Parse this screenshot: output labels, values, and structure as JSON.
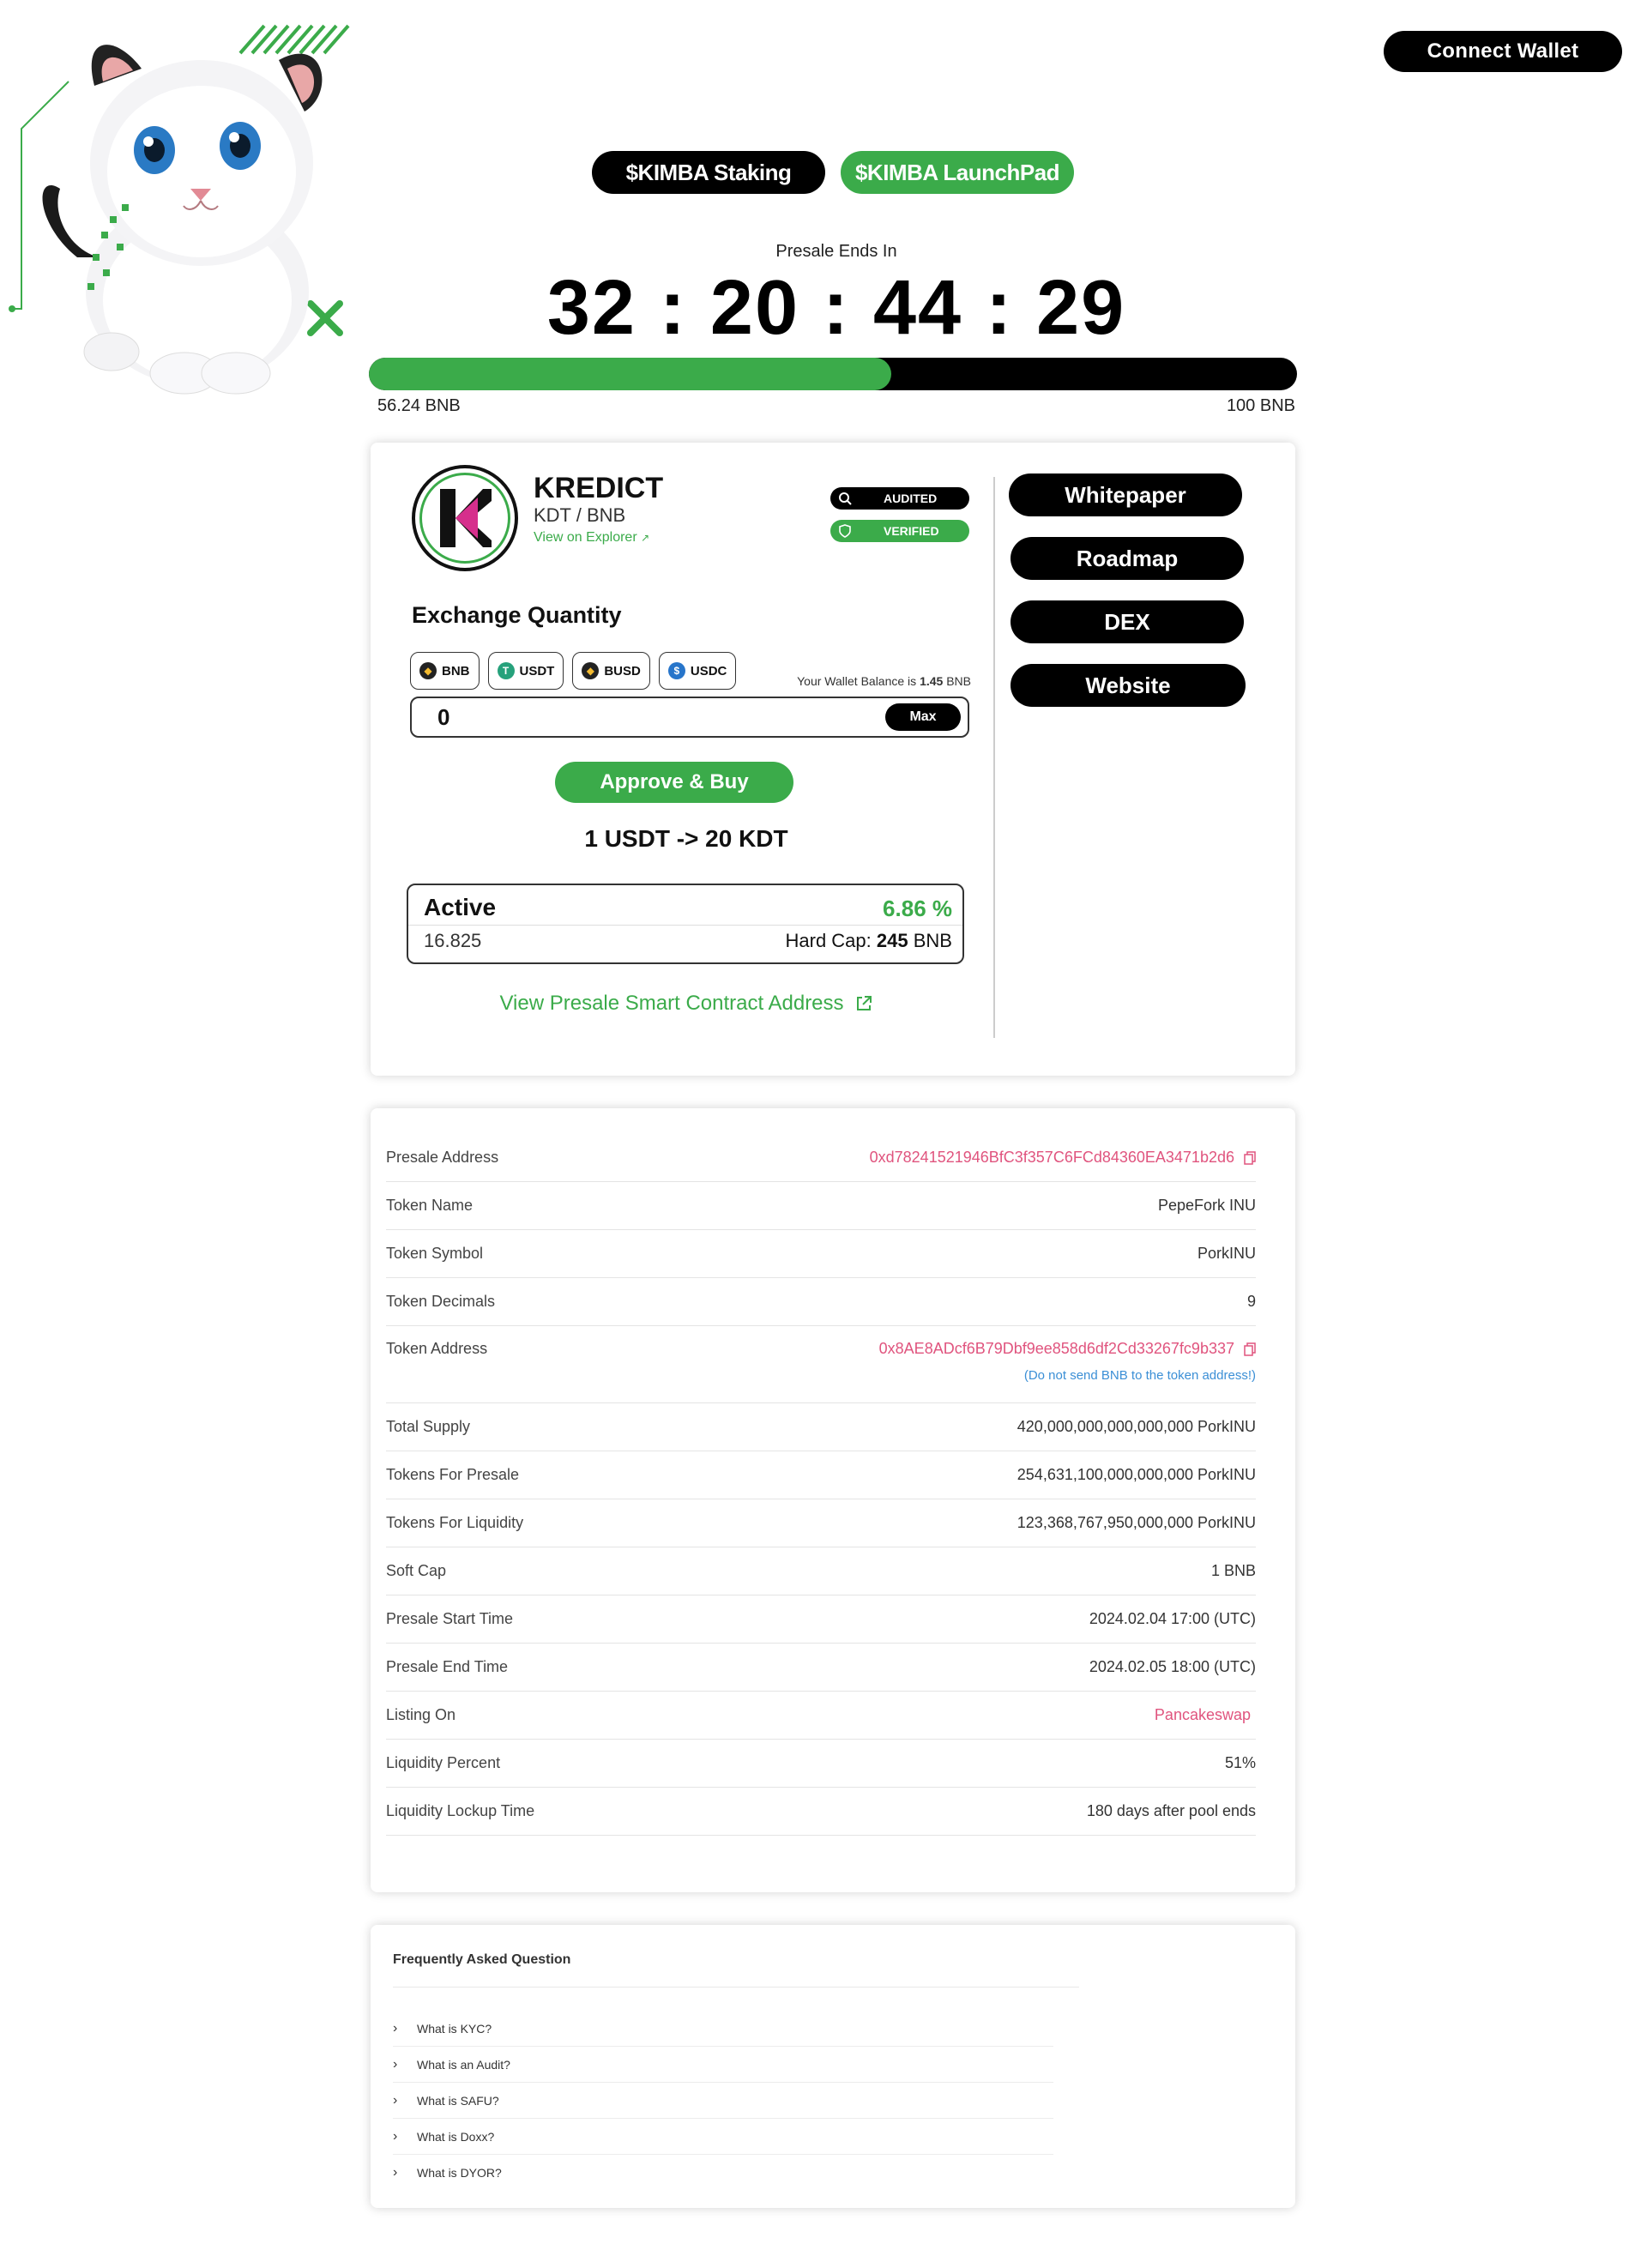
{
  "header": {
    "connect_label": "Connect Wallet",
    "tabs": [
      "$KIMBA Staking",
      "$KIMBA LaunchPad"
    ]
  },
  "presale": {
    "label": "Presale Ends In",
    "countdown": "32 : 20 : 44 : 29",
    "progress_fraction": 0.5624,
    "raised_label": "56.24 BNB",
    "goal_label": "100 BNB"
  },
  "token": {
    "name": "KREDICT",
    "pair": "KDT / BNB",
    "explorer_label": "View on Explorer",
    "badges": [
      "AUDITED",
      "VERIFIED"
    ]
  },
  "exchange": {
    "title": "Exchange Quantity",
    "currencies": [
      "BNB",
      "USDT",
      "BUSD",
      "USDC"
    ],
    "wallet_balance_prefix": "Your Wallet Balance is",
    "wallet_balance_value": "1.45",
    "wallet_balance_unit": "BNB",
    "amount_value": "0",
    "max_label": "Max",
    "approve_label": "Approve & Buy",
    "rate": "1 USDT -> 20 KDT"
  },
  "status": {
    "label": "Active",
    "percent": "6.86 %",
    "raised": "16.825",
    "hardcap_prefix": "Hard Cap:",
    "hardcap_value": "245",
    "hardcap_unit": "BNB"
  },
  "contract_link_label": "View Presale Smart Contract Address",
  "side_buttons": [
    "Whitepaper",
    "Roadmap",
    "DEX",
    "Website"
  ],
  "info": [
    {
      "label": "Presale Address",
      "value": "0xd78241521946BfC3f357C6FCd84360EA3471b2d6"
    },
    {
      "label": "Token Name",
      "value": "PepeFork INU"
    },
    {
      "label": "Token Symbol",
      "value": "PorkINU"
    },
    {
      "label": "Token Decimals",
      "value": "9"
    },
    {
      "label": "Token Address",
      "value": "0x8AE8ADcf6B79Dbf9ee858d6df2Cd33267fc9b337",
      "note": "(Do not send BNB to the token address!)"
    },
    {
      "label": "Total Supply",
      "value": "420,000,000,000,000,000 PorkINU"
    },
    {
      "label": "Tokens For Presale",
      "value": "254,631,100,000,000,000 PorkINU"
    },
    {
      "label": "Tokens For Liquidity",
      "value": "123,368,767,950,000,000 PorkINU"
    },
    {
      "label": "Soft Cap",
      "value": "1 BNB"
    },
    {
      "label": "Presale Start Time",
      "value": "2024.02.04 17:00 (UTC)"
    },
    {
      "label": "Presale End Time",
      "value": "2024.02.05 18:00 (UTC)"
    },
    {
      "label": "Listing On",
      "value": "Pancakeswap"
    },
    {
      "label": "Liquidity Percent",
      "value": "51%"
    },
    {
      "label": "Liquidity Lockup Time",
      "value": "180 days after pool ends"
    }
  ],
  "faq": {
    "title": "Frequently Asked Question",
    "items": [
      "What is KYC?",
      "What is an Audit?",
      "What is SAFU?",
      "What is Doxx?",
      "What is DYOR?"
    ]
  },
  "colors": {
    "accent_green": "#3bab4a",
    "link_pink": "#e0547e",
    "note_blue": "#3b8fd6",
    "dark": "#000000"
  }
}
